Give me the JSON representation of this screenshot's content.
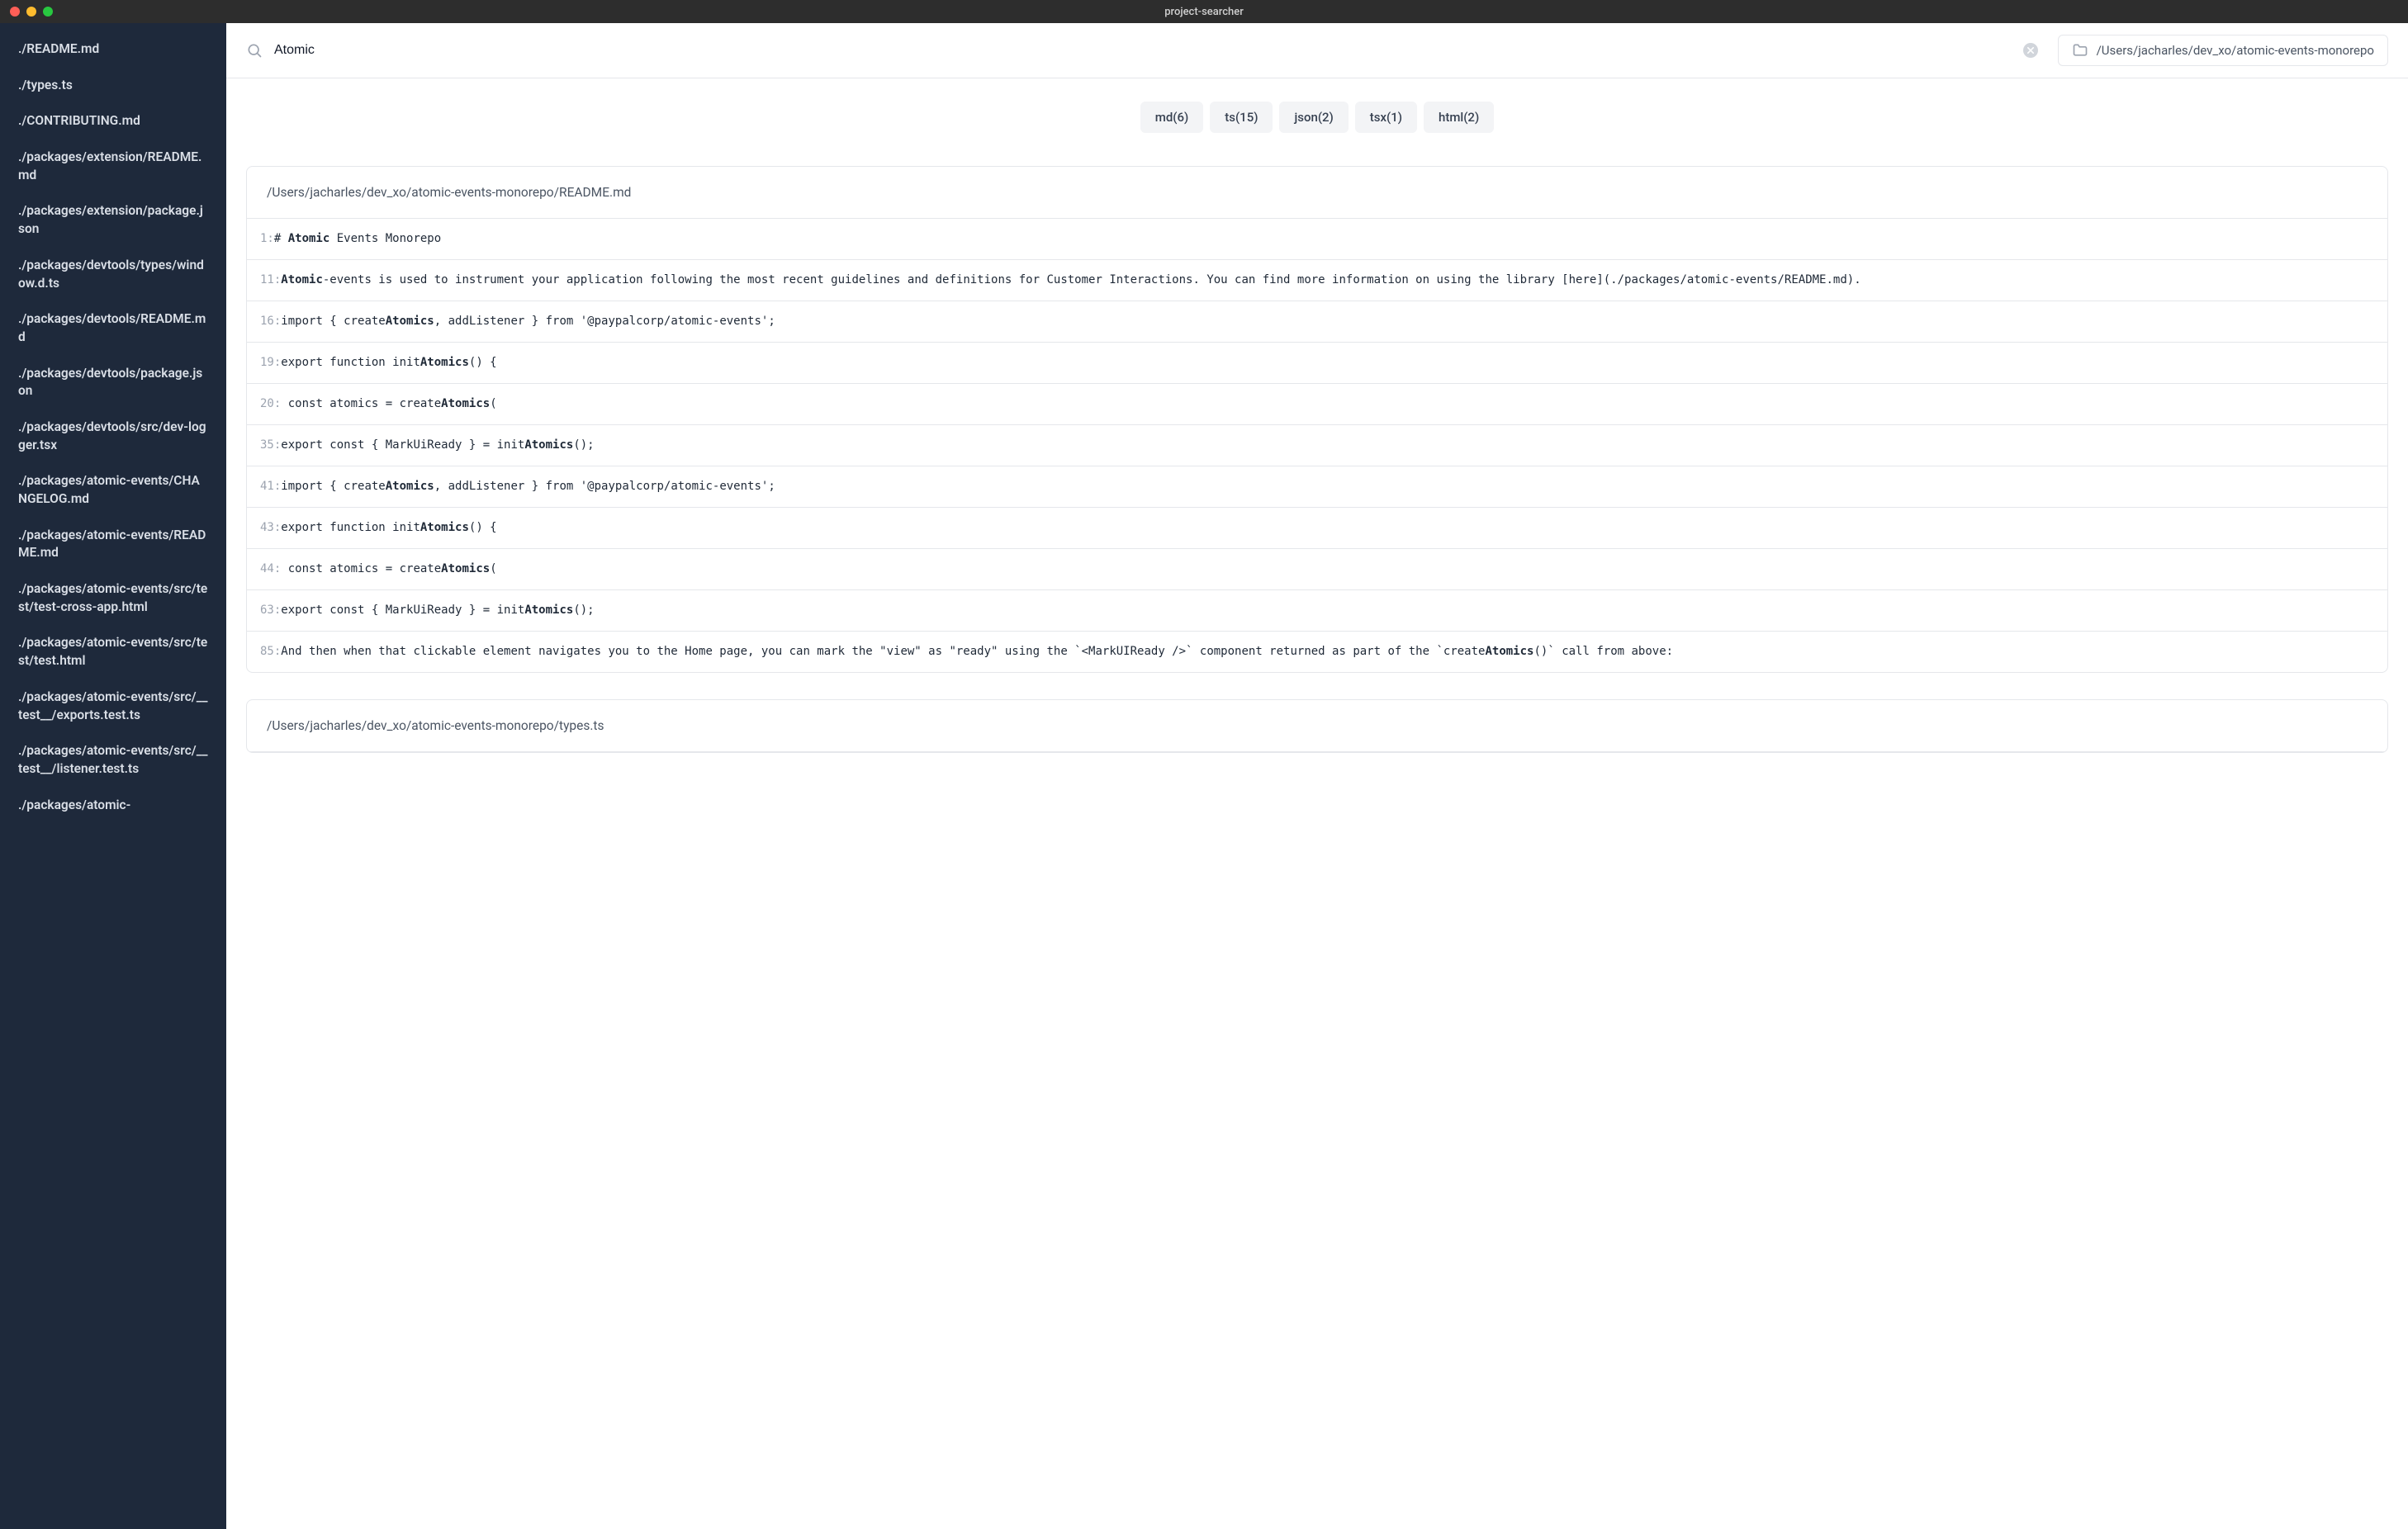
{
  "window": {
    "title": "project-searcher"
  },
  "search": {
    "query": "Atomic",
    "path": "/Users/jacharles/dev_xo/atomic-events-monorepo"
  },
  "sidebar": {
    "items": [
      "./README.md",
      "./types.ts",
      "./CONTRIBUTING.md",
      "./packages/extension/README.md",
      "./packages/extension/package.json",
      "./packages/devtools/types/window.d.ts",
      "./packages/devtools/README.md",
      "./packages/devtools/package.json",
      "./packages/devtools/src/dev-logger.tsx",
      "./packages/atomic-events/CHANGELOG.md",
      "./packages/atomic-events/README.md",
      "./packages/atomic-events/src/test/test-cross-app.html",
      "./packages/atomic-events/src/test/test.html",
      "./packages/atomic-events/src/__test__/exports.test.ts",
      "./packages/atomic-events/src/__test__/listener.test.ts",
      "./packages/atomic-"
    ]
  },
  "filters": [
    {
      "label": "md(6)"
    },
    {
      "label": "ts(15)"
    },
    {
      "label": "json(2)"
    },
    {
      "label": "tsx(1)"
    },
    {
      "label": "html(2)"
    }
  ],
  "results": [
    {
      "path": "/Users/jacharles/dev_xo/atomic-events-monorepo/README.md",
      "lines": [
        {
          "n": "1",
          "pre": "# ",
          "hl": "Atomic",
          "post": " Events Monorepo"
        },
        {
          "n": "11",
          "pre": "",
          "hl": "Atomic",
          "post": "-events is used to instrument your application following the most recent guidelines and definitions for Customer Interactions. You can find more information on using the library [here](./packages/atomic-events/README.md)."
        },
        {
          "n": "16",
          "pre": "import { create",
          "hl": "Atomics",
          "post": ", addListener } from '@paypalcorp/atomic-events';"
        },
        {
          "n": "19",
          "pre": "export function init",
          "hl": "Atomics",
          "post": "() {"
        },
        {
          "n": "20",
          "pre": " const atomics = create",
          "hl": "Atomics",
          "post": "("
        },
        {
          "n": "35",
          "pre": "export const { MarkUiReady } = init",
          "hl": "Atomics",
          "post": "();"
        },
        {
          "n": "41",
          "pre": "import { create",
          "hl": "Atomics",
          "post": ", addListener } from '@paypalcorp/atomic-events';"
        },
        {
          "n": "43",
          "pre": "export function init",
          "hl": "Atomics",
          "post": "() {"
        },
        {
          "n": "44",
          "pre": " const atomics = create",
          "hl": "Atomics",
          "post": "("
        },
        {
          "n": "63",
          "pre": "export const { MarkUiReady } = init",
          "hl": "Atomics",
          "post": "();"
        },
        {
          "n": "85",
          "pre": "And then when that clickable element navigates you to the Home page, you can mark the \"view\" as \"ready\" using the `<MarkUIReady />` component returned as part of the `create",
          "hl": "Atomics",
          "post": "()` call from above:"
        }
      ]
    },
    {
      "path": "/Users/jacharles/dev_xo/atomic-events-monorepo/types.ts",
      "lines": []
    }
  ]
}
